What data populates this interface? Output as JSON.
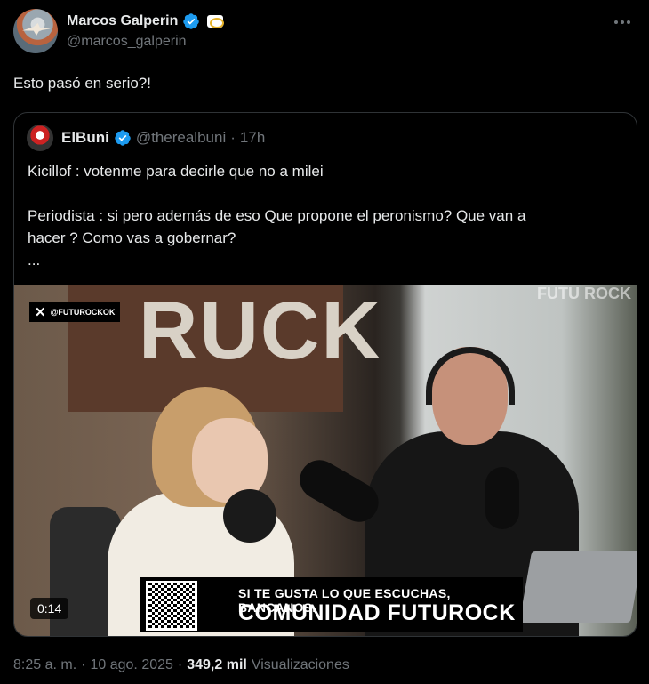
{
  "author": {
    "name": "Marcos Galperin",
    "handle": "@marcos_galperin"
  },
  "tweet": {
    "text": "Esto pasó en serio?!"
  },
  "quoted": {
    "name": "ElBuni",
    "handle": "@therealbuni",
    "separator": "·",
    "time": "17h",
    "lines": [
      "Kicillof : votenme para decirle que no a milei",
      "Periodista : si pero además de eso  Que propone el peronismo? Que van a",
      "hacer ? Como vas a gobernar?",
      "..."
    ],
    "video": {
      "watermark": "@FUTUROCKOK",
      "sign_text": "RUCK",
      "logo_text": "FUTU ROCK",
      "banner_line1": "SI TE GUSTA LO QUE ESCUCHAS, BANCANOS.",
      "banner_line2": "COMUNIDAD FUTUROCK",
      "duration": "0:14"
    }
  },
  "meta": {
    "time": "8:25 a. m.",
    "separator": "·",
    "date": "10 ago. 2025",
    "views_count": "349,2 mil",
    "views_label": "Visualizaciones"
  },
  "colors": {
    "background": "#000000",
    "text": "#e7e9ea",
    "secondary": "#71767b",
    "verified": "#1d9bf0",
    "border": "#2f3336"
  }
}
